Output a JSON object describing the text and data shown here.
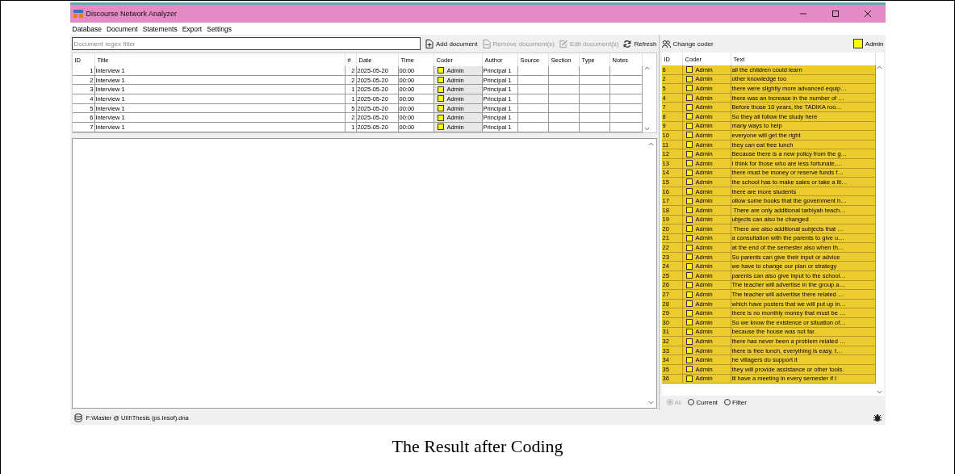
{
  "window": {
    "title": "Discourse Network Analyzer"
  },
  "menu": [
    "Database",
    "Document",
    "Statements",
    "Export",
    "Settings"
  ],
  "document_filter": {
    "placeholder": "Document regex filter"
  },
  "document_toolbar": [
    {
      "kind": "add",
      "label": "Add document",
      "disabled": false
    },
    {
      "kind": "remove",
      "label": "Remove document(s)",
      "disabled": true
    },
    {
      "kind": "edit",
      "label": "Edit document(s)",
      "disabled": true
    },
    {
      "kind": "refresh",
      "label": "Refresh",
      "disabled": false
    }
  ],
  "documents": {
    "columns": [
      "ID",
      "Title",
      "#",
      "Date",
      "Time",
      "Coder",
      "Author",
      "Source",
      "Section",
      "Type",
      "Notes"
    ],
    "rows": [
      {
        "id": "1",
        "title": "Interview 1",
        "count": "2",
        "date": "2025-05-20",
        "time": "00:00",
        "coder": "Admin",
        "color": "#ffff00",
        "author": "Principal 1"
      },
      {
        "id": "2",
        "title": "Interview 1",
        "count": "2",
        "date": "2025-05-20",
        "time": "00:00",
        "coder": "Admin",
        "color": "#ffff00",
        "author": "Principal 1"
      },
      {
        "id": "3",
        "title": "Interview 1",
        "count": "1",
        "date": "2025-05-20",
        "time": "00:00",
        "coder": "Admin",
        "color": "#ffff00",
        "author": "Principal 1"
      },
      {
        "id": "4",
        "title": "Interview 1",
        "count": "1",
        "date": "2025-05-20",
        "time": "00:00",
        "coder": "Admin",
        "color": "#ffff00",
        "author": "Principal 1"
      },
      {
        "id": "5",
        "title": "Interview 1",
        "count": "5",
        "date": "2025-05-20",
        "time": "00:00",
        "coder": "Admin",
        "color": "#ffff00",
        "author": "Principal 1"
      },
      {
        "id": "6",
        "title": "Interview 1",
        "count": "2",
        "date": "2025-05-20",
        "time": "00:00",
        "coder": "Admin",
        "color": "#ffff00",
        "author": "Principal 1"
      },
      {
        "id": "7",
        "title": "Interview 1",
        "count": "1",
        "date": "2025-05-20",
        "time": "00:00",
        "coder": "Admin",
        "color": "#ffff00",
        "author": "Principal 1"
      }
    ]
  },
  "statement_toolbar": {
    "change_coder": "Change coder",
    "current_coder": "Admin",
    "color": "#ffff00"
  },
  "statements": {
    "columns": [
      "ID",
      "Coder",
      "Text"
    ],
    "rows": [
      {
        "id": "6",
        "coder": "Admin",
        "color": "#ffff00",
        "text": "all the children could learn"
      },
      {
        "id": "2",
        "coder": "Admin",
        "color": "#ffff00",
        "text": "other knowledge too"
      },
      {
        "id": "5",
        "coder": "Admin",
        "color": "#ffff00",
        "text": "there were slightly more advanced equip…"
      },
      {
        "id": "4",
        "coder": "Admin",
        "color": "#ffff00",
        "text": "there was an increase in the number of …"
      },
      {
        "id": "7",
        "coder": "Admin",
        "color": "#ffff00",
        "text": "Before those 10 years, the TADIKA roo…"
      },
      {
        "id": "8",
        "coder": "Admin",
        "color": "#ffff00",
        "text": "So they all follow the study here"
      },
      {
        "id": "9",
        "coder": "Admin",
        "color": "#ffff00",
        "text": "many ways to help"
      },
      {
        "id": "10",
        "coder": "Admin",
        "color": "#ffff00",
        "text": "everyone will get the right"
      },
      {
        "id": "11",
        "coder": "Admin",
        "color": "#ffff00",
        "text": "they can eat free lunch"
      },
      {
        "id": "12",
        "coder": "Admin",
        "color": "#ffff00",
        "text": "Because there is a new policy from the g…"
      },
      {
        "id": "13",
        "coder": "Admin",
        "color": "#ffff00",
        "text": "I think for those who are less fortunate,…"
      },
      {
        "id": "14",
        "coder": "Admin",
        "color": "#ffff00",
        "text": "there must be money or reserve funds f…"
      },
      {
        "id": "15",
        "coder": "Admin",
        "color": "#ffff00",
        "text": "the school has to make sales or take a lit…"
      },
      {
        "id": "16",
        "coder": "Admin",
        "color": "#ffff00",
        "text": "there are more students"
      },
      {
        "id": "17",
        "coder": "Admin",
        "color": "#ffff00",
        "text": "ollow some books that the government h…"
      },
      {
        "id": "18",
        "coder": "Admin",
        "color": "#ffff00",
        "text": " There are only additional tarbiyah teach…"
      },
      {
        "id": "19",
        "coder": "Admin",
        "color": "#ffff00",
        "text": "ubjects can also be changed"
      },
      {
        "id": "20",
        "coder": "Admin",
        "color": "#ffff00",
        "text": " There are also additional subjects that …"
      },
      {
        "id": "21",
        "coder": "Admin",
        "color": "#ffff00",
        "text": "a consultation with the parents to give u…"
      },
      {
        "id": "22",
        "coder": "Admin",
        "color": "#ffff00",
        "text": "at the end of the semester also when th…"
      },
      {
        "id": "23",
        "coder": "Admin",
        "color": "#ffff00",
        "text": "So parents can give their input or advice"
      },
      {
        "id": "24",
        "coder": "Admin",
        "color": "#ffff00",
        "text": "we have to change our plan or strategy"
      },
      {
        "id": "25",
        "coder": "Admin",
        "color": "#ffff00",
        "text": "parents can also give input to the school…"
      },
      {
        "id": "26",
        "coder": "Admin",
        "color": "#ffff00",
        "text": "The teacher will advertise in the group a…"
      },
      {
        "id": "27",
        "coder": "Admin",
        "color": "#ffff00",
        "text": "The teacher will advertise there related …"
      },
      {
        "id": "28",
        "coder": "Admin",
        "color": "#ffff00",
        "text": "which have posters that we will put up in…"
      },
      {
        "id": "29",
        "coder": "Admin",
        "color": "#ffff00",
        "text": "there is no monthly money that must be …"
      },
      {
        "id": "30",
        "coder": "Admin",
        "color": "#ffff00",
        "text": "So we know the existence or situation of…"
      },
      {
        "id": "31",
        "coder": "Admin",
        "color": "#ffff00",
        "text": "because the house was not far."
      },
      {
        "id": "32",
        "coder": "Admin",
        "color": "#ffff00",
        "text": "there has never been a problem related …"
      },
      {
        "id": "33",
        "coder": "Admin",
        "color": "#ffff00",
        "text": "there is free lunch, everything is easy, t…"
      },
      {
        "id": "34",
        "coder": "Admin",
        "color": "#ffff00",
        "text": "he villagers do support it"
      },
      {
        "id": "35",
        "coder": "Admin",
        "color": "#ffff00",
        "text": "they will provide assistance or other tools."
      },
      {
        "id": "36",
        "coder": "Admin",
        "color": "#ffff00",
        "text": "ill have a meeting in every semester if I"
      }
    ]
  },
  "statement_filter": [
    {
      "label": "All",
      "selected": true,
      "disabled": true
    },
    {
      "label": "Current",
      "selected": false,
      "disabled": false
    },
    {
      "label": "Filter",
      "selected": false,
      "disabled": false
    }
  ],
  "status_bar": {
    "path": "F:\\Master @ UIII\\Thesis (ps.Insof).dna"
  },
  "caption": "The Result after Coding"
}
